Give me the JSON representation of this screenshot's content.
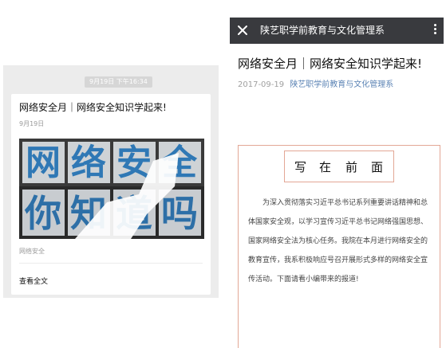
{
  "chat_card": {
    "timestamp": "9月19日 下午16:34",
    "title": "网络安全月｜网络安全知识学起来!",
    "date": "9月19日",
    "cover": {
      "top_chars": [
        "网",
        "络",
        "安",
        "全"
      ],
      "bottom_chars": [
        "你",
        "知",
        "道",
        "吗"
      ],
      "top_color": "#2f78b5",
      "bottom_color": "#2d6fa7"
    },
    "tag": "网络安全",
    "read_more": "查看全文"
  },
  "article": {
    "topbar": {
      "title": "陕艺职学前教育与文化管理系",
      "close_icon": "close-icon",
      "more_icon": "more-vertical-icon"
    },
    "title": "网络安全月｜网络安全知识学起来!",
    "date": "2017-09-19",
    "author": "陕艺职学前教育与文化管理系",
    "heading_chars": [
      "写",
      "在",
      "前",
      "面"
    ],
    "paragraph_lines": [
      "为深入贯彻落实习近平总书记系列重要讲话精神和总",
      "体国家安全观，以学习宣传习近平总书记网络强国思想、",
      "国家网络安全法为核心任务。我院在本月进行网络安全的",
      "教育宣传，我系积极响应号召开展形式多样的网络安全宣",
      "传活动。下面请看小编带来的报道!"
    ],
    "frame_color": "#e3a795"
  }
}
